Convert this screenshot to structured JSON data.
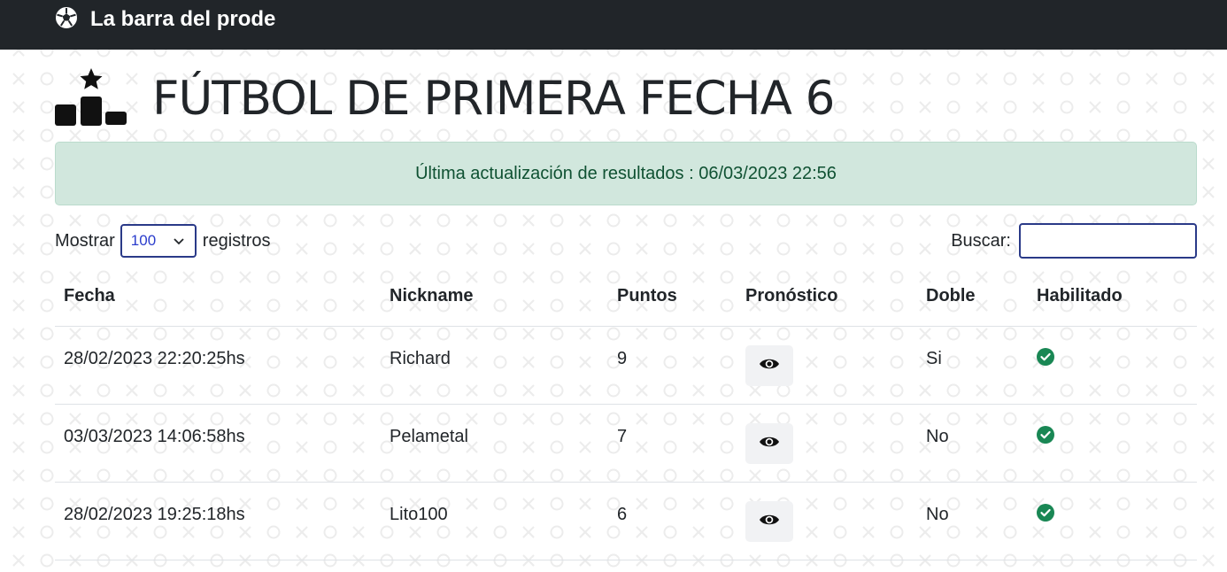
{
  "navbar": {
    "brand": "La barra del prode",
    "icon": "soccer-ball-icon"
  },
  "page": {
    "title": "FÚTBOL DE PRIMERA FECHA 6",
    "title_icon": "podium-star-icon"
  },
  "alert": {
    "text": "Última actualización de resultados : 06/03/2023 22:56",
    "color": "#0f5132"
  },
  "table_controls": {
    "show_label": "Mostrar",
    "page_length": "100",
    "records_label": "registros",
    "search_label": "Buscar:",
    "search_value": ""
  },
  "table": {
    "headers": {
      "fecha": "Fecha",
      "nickname": "Nickname",
      "puntos": "Puntos",
      "pronostico": "Pronóstico",
      "doble": "Doble",
      "habilitado": "Habilitado"
    },
    "rows": [
      {
        "fecha": "28/02/2023 22:20:25hs",
        "nickname": "Richard",
        "puntos": "9",
        "doble": "Si",
        "habilitado": true
      },
      {
        "fecha": "03/03/2023 14:06:58hs",
        "nickname": "Pelametal",
        "puntos": "7",
        "doble": "No",
        "habilitado": true
      },
      {
        "fecha": "28/02/2023 19:25:18hs",
        "nickname": "Lito100",
        "puntos": "6",
        "doble": "No",
        "habilitado": true
      }
    ]
  },
  "icons": {
    "view": "eye-icon",
    "enabled": "check-circle-icon",
    "select": "chevron-down-icon"
  },
  "colors": {
    "navbar_bg": "#212529",
    "success": "#198754",
    "alert_bg": "#d1e7dd",
    "input_border": "#2a3a88"
  }
}
